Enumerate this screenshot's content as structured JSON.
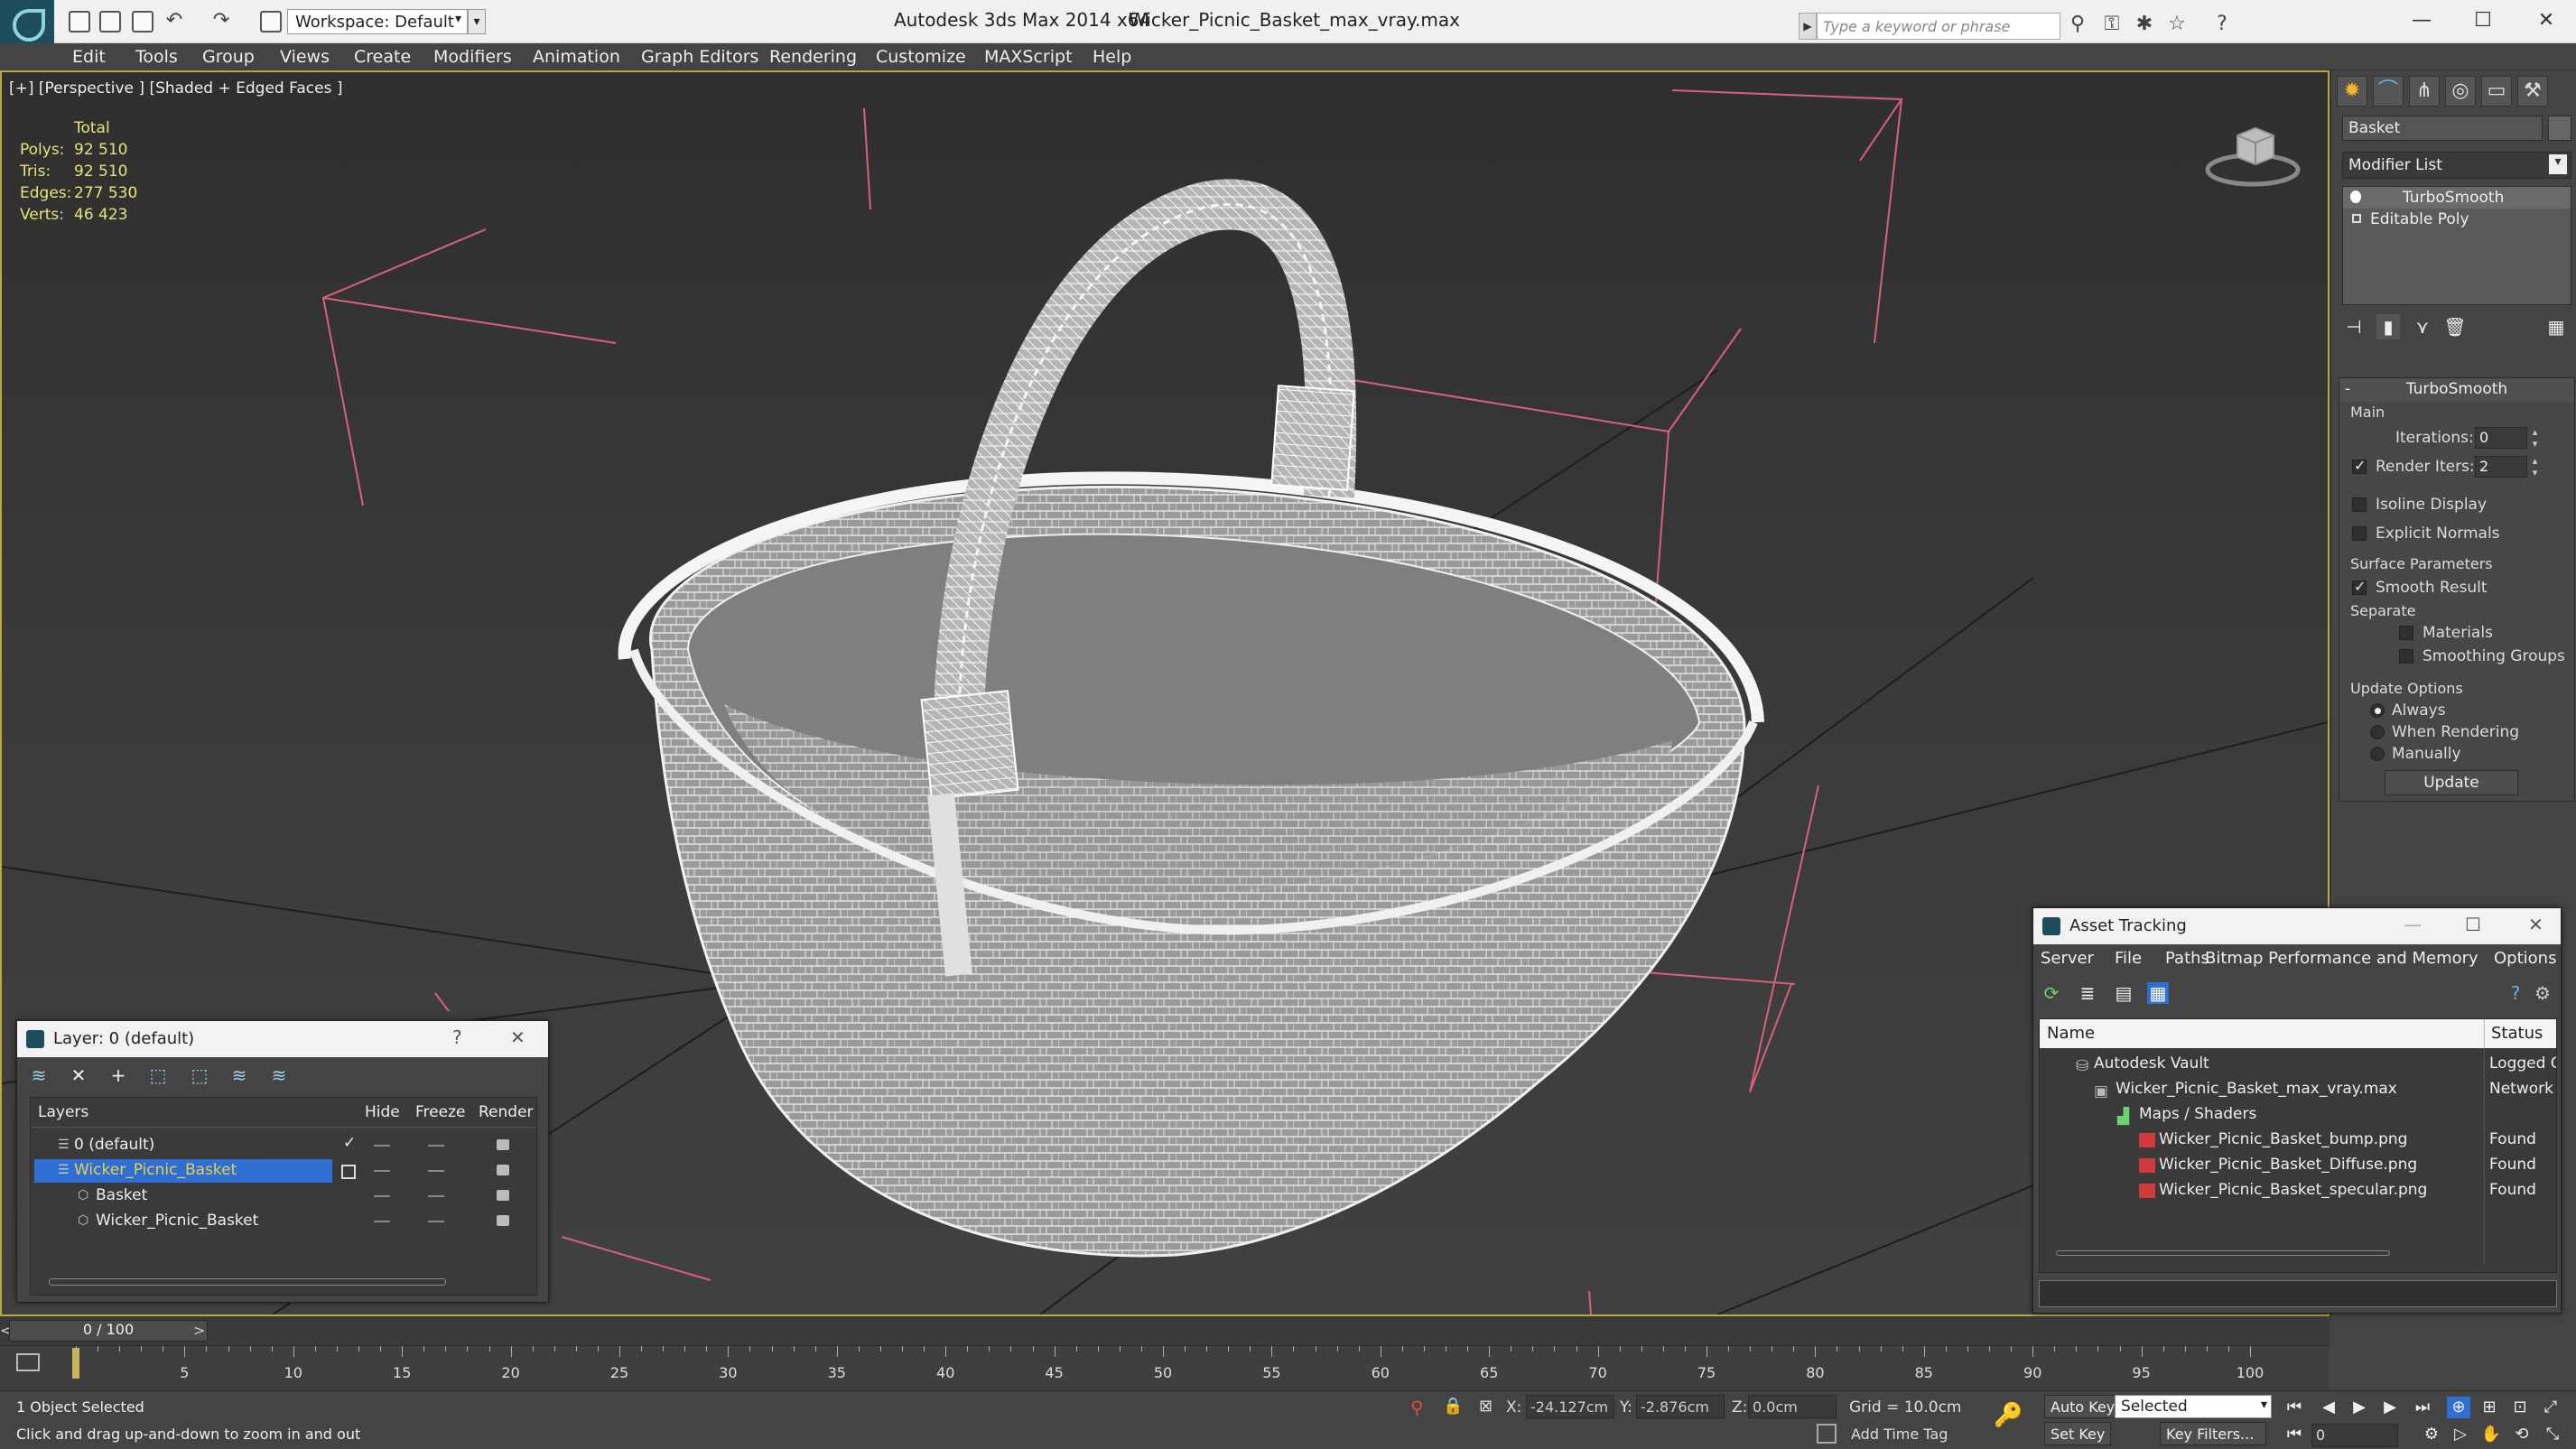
{
  "titlebar": {
    "workspace": "Workspace: Default",
    "app_title": "Autodesk 3ds Max  2014 x64",
    "file_title": "Wicker_Picnic_Basket_max_vray.max",
    "search_placeholder": "Type a keyword or phrase"
  },
  "menu": [
    "Edit",
    "Tools",
    "Group",
    "Views",
    "Create",
    "Modifiers",
    "Animation",
    "Graph Editors",
    "Rendering",
    "Customize",
    "MAXScript",
    "Help"
  ],
  "viewport": {
    "label": "[+] [Perspective ] [Shaded + Edged Faces ]",
    "stats_header": "Total",
    "stats": [
      {
        "label": "Polys:",
        "value": "92 510"
      },
      {
        "label": "Tris:",
        "value": "92 510"
      },
      {
        "label": "Edges:",
        "value": "277 530"
      },
      {
        "label": "Verts:",
        "value": "46 423"
      }
    ]
  },
  "command_panel": {
    "object_name": "Basket",
    "modifier_list": "Modifier List",
    "stack": [
      "TurboSmooth",
      "Editable Poly"
    ],
    "rollout_title": "TurboSmooth",
    "main_label": "Main",
    "iterations_label": "Iterations:",
    "iterations_value": "0",
    "render_iters_label": "Render Iters:",
    "render_iters_value": "2",
    "render_iters_checked": true,
    "isoline_label": "Isoline Display",
    "explicit_normals_label": "Explicit Normals",
    "surface_params_label": "Surface Parameters",
    "smooth_result_label": "Smooth Result",
    "separate_label": "Separate",
    "materials_label": "Materials",
    "smoothing_groups_label": "Smoothing Groups",
    "update_options_label": "Update Options",
    "always_label": "Always",
    "when_rendering_label": "When Rendering",
    "manually_label": "Manually",
    "update_button": "Update"
  },
  "layer_dialog": {
    "title": "Layer: 0 (default)",
    "help": "?",
    "columns": {
      "layers": "Layers",
      "hide": "Hide",
      "freeze": "Freeze",
      "render": "Render"
    },
    "rows": [
      {
        "name": "0 (default)",
        "selected": false,
        "indent": 1
      },
      {
        "name": "Wicker_Picnic_Basket",
        "selected": true,
        "indent": 1
      },
      {
        "name": "Basket",
        "selected": false,
        "indent": 2
      },
      {
        "name": "Wicker_Picnic_Basket",
        "selected": false,
        "indent": 2
      }
    ]
  },
  "asset_dialog": {
    "title": "Asset Tracking",
    "menu": [
      "Server",
      "File",
      "Paths",
      "Bitmap Performance and Memory",
      "Options"
    ],
    "columns": {
      "name": "Name",
      "status": "Status"
    },
    "rows": [
      {
        "name": "Autodesk Vault",
        "status": "Logged O",
        "indent": 1
      },
      {
        "name": "Wicker_Picnic_Basket_max_vray.max",
        "status": "Network F",
        "indent": 2
      },
      {
        "name": "Maps / Shaders",
        "status": "",
        "indent": 3
      },
      {
        "name": "Wicker_Picnic_Basket_bump.png",
        "status": "Found",
        "indent": 4
      },
      {
        "name": "Wicker_Picnic_Basket_Diffuse.png",
        "status": "Found",
        "indent": 4
      },
      {
        "name": "Wicker_Picnic_Basket_specular.png",
        "status": "Found",
        "indent": 4
      }
    ]
  },
  "timeline": {
    "slider_label": "0 / 100",
    "ticks": [
      5,
      10,
      15,
      20,
      25,
      30,
      35,
      40,
      45,
      50,
      55,
      60,
      65,
      70,
      75,
      80,
      85,
      90,
      95,
      100
    ]
  },
  "status": {
    "selection": "1 Object Selected",
    "prompt": "Click and drag up-and-down to zoom in and out",
    "x_label": "X:",
    "x_value": "-24.127cm",
    "y_label": "Y:",
    "y_value": "-2.876cm",
    "z_label": "Z:",
    "z_value": "0.0cm",
    "grid": "Grid = 10.0cm",
    "add_time_tag": "Add Time Tag",
    "auto_key": "Auto Key",
    "set_key": "Set Key",
    "selected_dropdown": "Selected",
    "key_filters": "Key Filters...",
    "frame_value": "0"
  },
  "colors": {
    "viewport_border": "#b9a74a",
    "stats_text": "#e8e27a",
    "selection_blue": "#2f6fd4",
    "bbox_pink": "#d9607a"
  }
}
